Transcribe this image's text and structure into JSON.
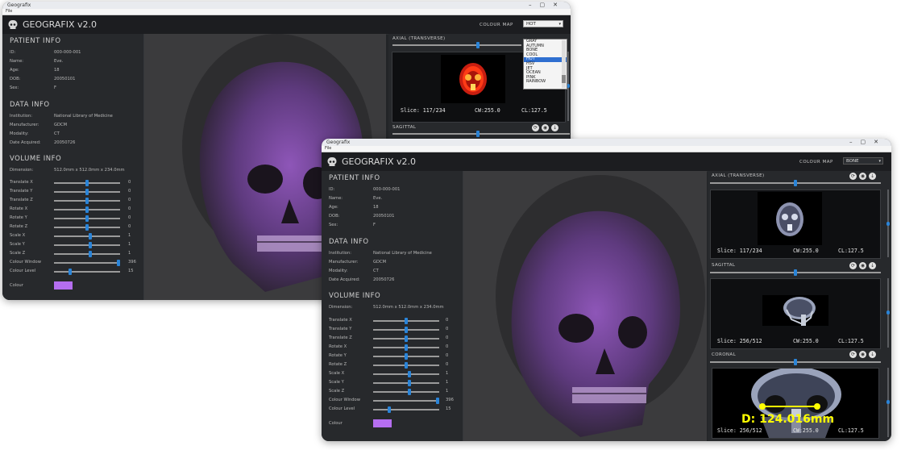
{
  "app": {
    "title": "Geografix",
    "brand": "GEOGRAFIX v2.0",
    "menu": "File"
  },
  "colour_map": {
    "label": "COLOUR MAP",
    "selected_back": "HOT",
    "selected_front": "BONE",
    "options": [
      "GRAY",
      "AUTUMN",
      "BONE",
      "COOL",
      "HOT",
      "HSV",
      "JET",
      "OCEAN",
      "PINK",
      "RAINBOW"
    ]
  },
  "patient_info": {
    "heading": "PATIENT INFO",
    "rows": [
      {
        "label": "ID:",
        "value": "000-000-001"
      },
      {
        "label": "Name:",
        "value": "Eve."
      },
      {
        "label": "Age:",
        "value": "18"
      },
      {
        "label": "DOB:",
        "value": "20050101"
      },
      {
        "label": "Sex:",
        "value": "F"
      }
    ]
  },
  "data_info": {
    "heading": "DATA INFO",
    "rows": [
      {
        "label": "Institution:",
        "value": "National Library of Medicine"
      },
      {
        "label": "Manufacturer:",
        "value": "GDCM"
      },
      {
        "label": "Modality:",
        "value": "CT"
      },
      {
        "label": "Date Acquired:",
        "value": "20050726"
      }
    ]
  },
  "volume_info": {
    "heading": "VOLUME INFO",
    "dimension_label": "Dimension:",
    "dimension_value": "512.0mm x 512.0mm x 234.0mm",
    "sliders": [
      {
        "label": "Translate X",
        "value": "0",
        "pos": 0.5
      },
      {
        "label": "Translate Y",
        "value": "0",
        "pos": 0.5
      },
      {
        "label": "Translate Z",
        "value": "0",
        "pos": 0.5
      },
      {
        "label": "Rotate X",
        "value": "0",
        "pos": 0.5
      },
      {
        "label": "Rotate Y",
        "value": "0",
        "pos": 0.5
      },
      {
        "label": "Rotate Z",
        "value": "0",
        "pos": 0.5
      },
      {
        "label": "Scale X",
        "value": "1",
        "pos": 0.55
      },
      {
        "label": "Scale Y",
        "value": "1",
        "pos": 0.55
      },
      {
        "label": "Scale Z",
        "value": "1",
        "pos": 0.55
      },
      {
        "label": "Colour Window",
        "value": "396",
        "pos": 0.97
      },
      {
        "label": "Colour Level",
        "value": "15",
        "pos": 0.24
      }
    ],
    "colour_label": "Colour",
    "colour": "#b56ef0"
  },
  "views": {
    "axial": {
      "title": "AXIAL (TRANSVERSE)",
      "slice": "Slice: 117/234",
      "cw": "CW:255.0",
      "cl": "CL:127.5"
    },
    "sagittal": {
      "title": "SAGITTAL",
      "slice": "Slice: 256/512",
      "cw": "CW:255.0",
      "cl": "CL:127.5"
    },
    "coronal": {
      "title": "CORONAL",
      "slice": "Slice: 256/512",
      "cw": "CW:255.0",
      "cl": "CL:127.5"
    }
  },
  "measurement": "D: 124.016mm",
  "colors": {
    "accent": "#2a84d8",
    "panel": "#27292c",
    "bg": "#222427",
    "measure": "#ffff00"
  }
}
